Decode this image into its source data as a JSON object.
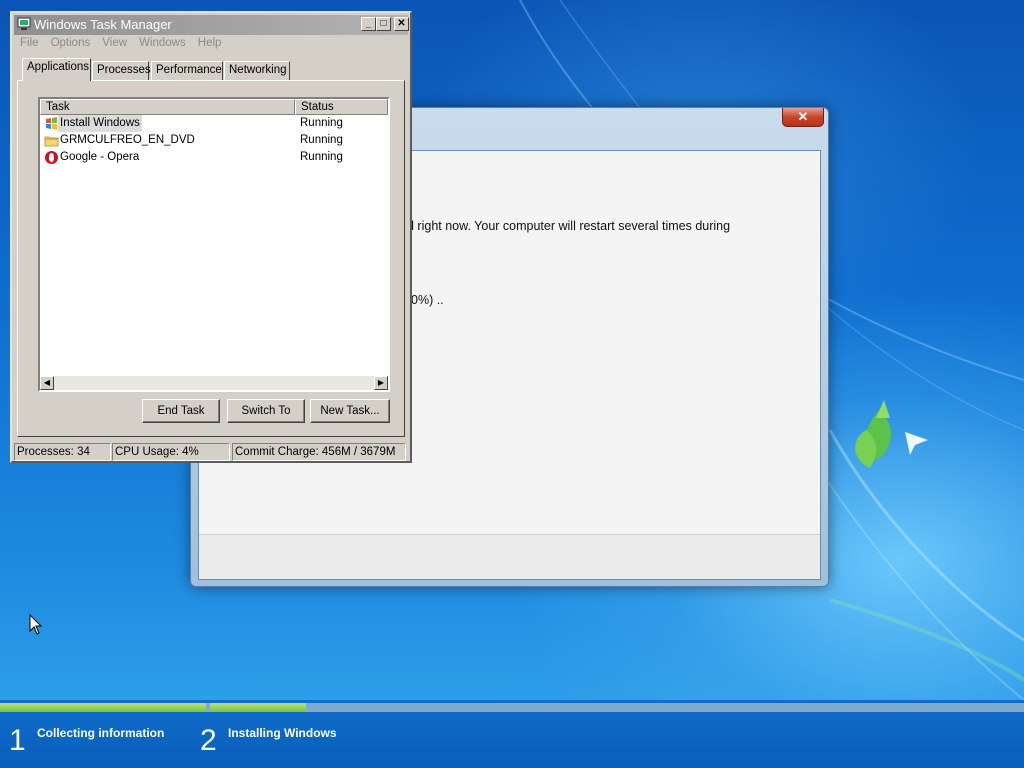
{
  "task_manager": {
    "title": "Windows Task Manager",
    "title_buttons": [
      "_",
      "□",
      "✕"
    ],
    "menu": [
      "File",
      "Options",
      "View",
      "Windows",
      "Help"
    ],
    "tabs": [
      "Applications",
      "Processes",
      "Performance",
      "Networking"
    ],
    "active_tab": "Applications",
    "columns": [
      "Task",
      "Status"
    ],
    "rows": [
      {
        "task": "Install Windows",
        "status": "Running",
        "icon": "windows-flag-icon"
      },
      {
        "task": "GRMCULFREO_EN_DVD",
        "status": "Running",
        "icon": "folder-icon"
      },
      {
        "task": "Google - Opera",
        "status": "Running",
        "icon": "opera-icon"
      }
    ],
    "buttons": {
      "end_task": "End Task",
      "switch_to": "Switch To",
      "new_task": "New Task..."
    },
    "status_bar": {
      "processes": "Processes: 34",
      "cpu": "CPU Usage: 4%",
      "commit": "Commit Charge: 456M / 3679M"
    }
  },
  "setup_window": {
    "close_label": "✕",
    "text_line_1": "d right now. Your computer will restart several times during",
    "text_line_2": "0%) .."
  },
  "progress": {
    "steps": [
      {
        "number": "1",
        "label": "Collecting information"
      },
      {
        "number": "2",
        "label": "Installing Windows"
      }
    ],
    "colors": {
      "complete": "#7cc13e",
      "remaining": "#7fa9cf"
    }
  }
}
